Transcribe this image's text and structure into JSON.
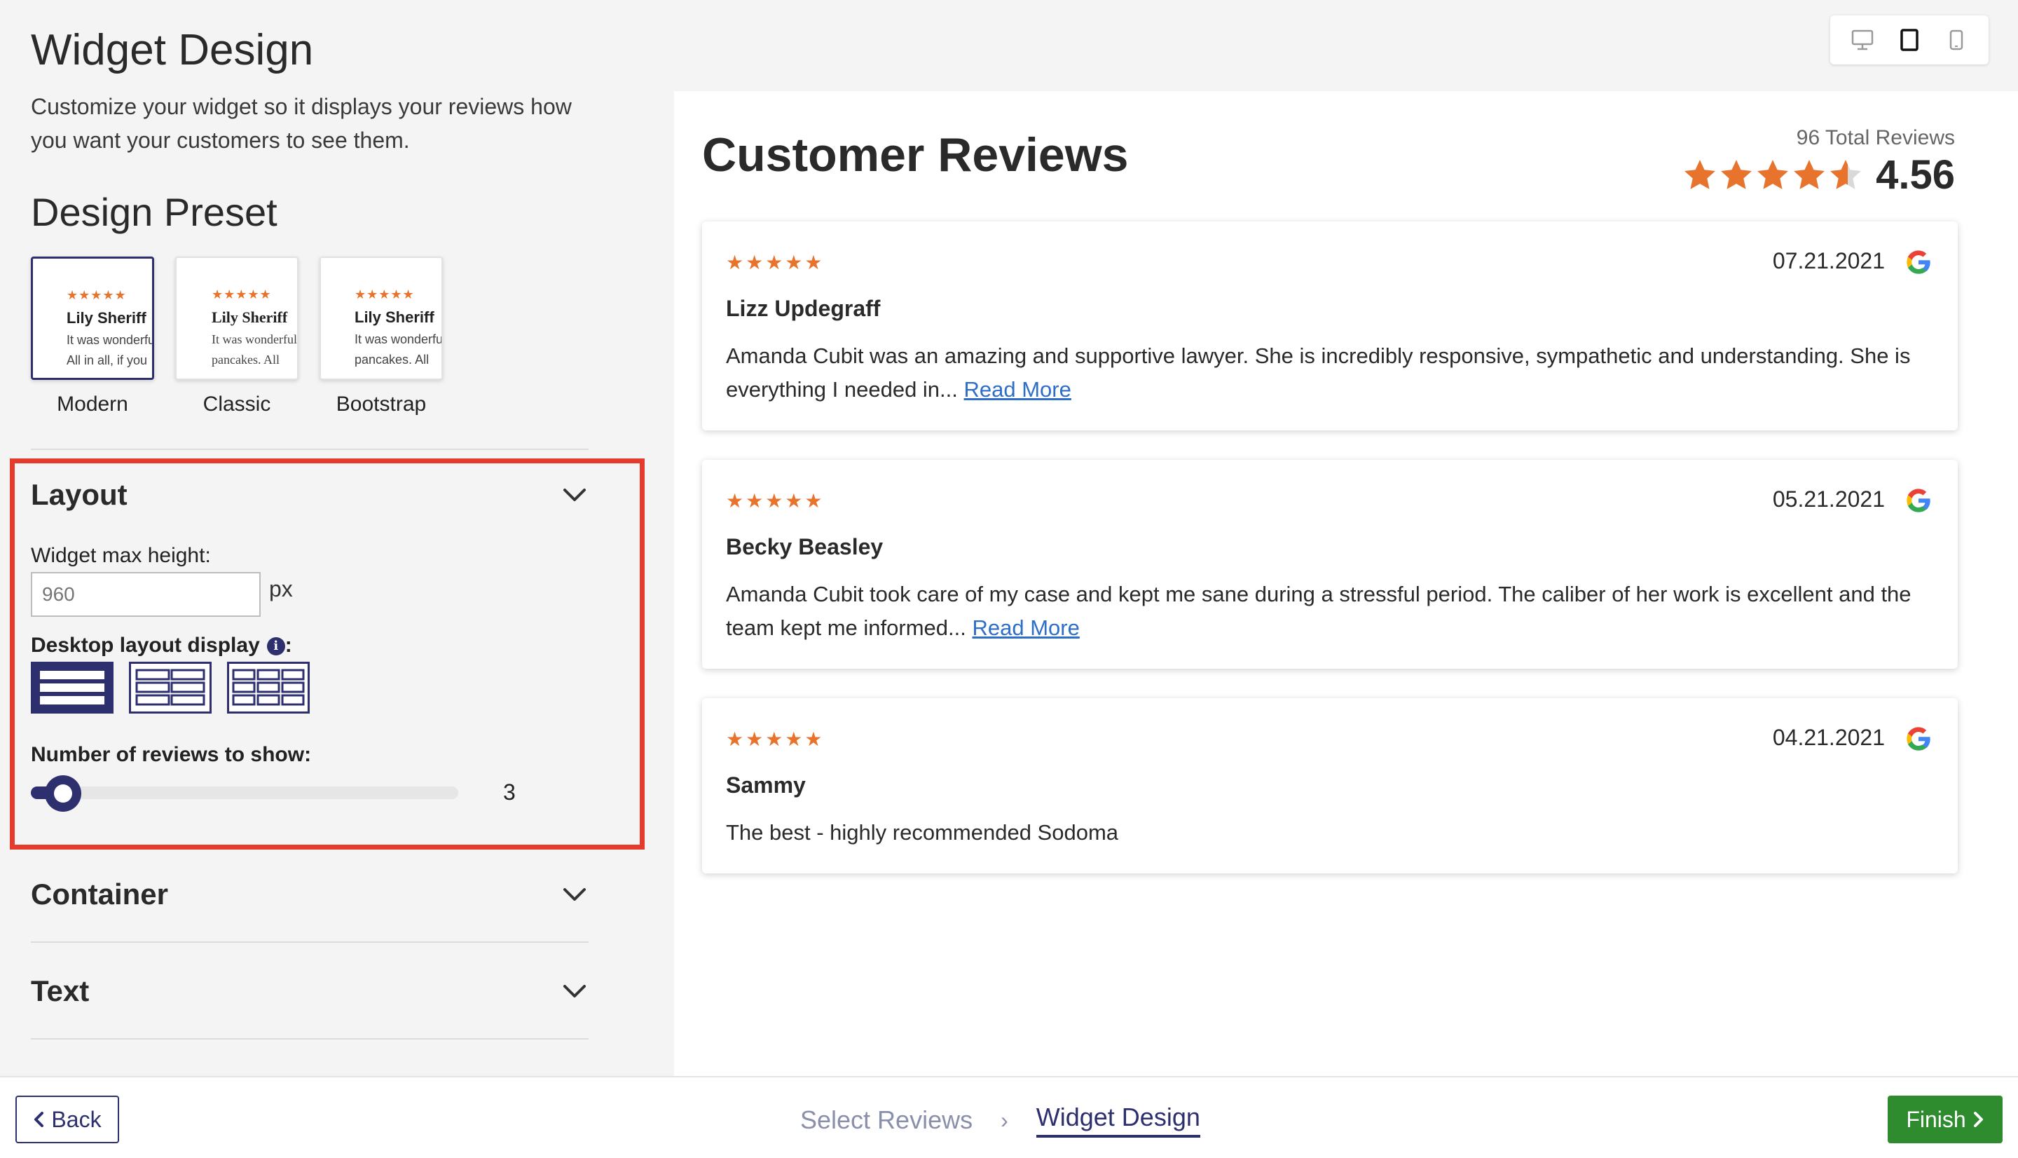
{
  "page": {
    "title": "Widget Design",
    "subtitle": "Customize your widget so it displays your reviews how you want your customers to see them."
  },
  "design_preset": {
    "title": "Design Preset",
    "presets": [
      {
        "label": "Modern",
        "name": "Lily Sheriff",
        "line1": "It was wonderful",
        "line2": "All in all, if you",
        "active": true
      },
      {
        "label": "Classic",
        "name": "Lily Sheriff",
        "line1": "It was wonderful",
        "line2": "pancakes. All",
        "active": false
      },
      {
        "label": "Bootstrap",
        "name": "Lily Sheriff",
        "line1": "It was wonderful",
        "line2": "pancakes. All",
        "active": false
      }
    ],
    "stars": "★★★★★"
  },
  "layout": {
    "title": "Layout",
    "max_height_label": "Widget max height:",
    "max_height_placeholder": "960",
    "unit": "px",
    "desktop_layout_label": "Desktop layout display",
    "info_glyph": "i",
    "colon": ":",
    "layout_options": [
      "one-column",
      "two-column",
      "three-column"
    ],
    "selected_layout": "one-column",
    "reviews_count_label": "Number of reviews to show:",
    "reviews_count": "3",
    "reviews_count_fraction": 0.0
  },
  "sections": {
    "container": "Container",
    "text": "Text"
  },
  "device_toggle": {
    "options": [
      "desktop-icon",
      "tablet-icon",
      "mobile-icon"
    ],
    "selected": "tablet-icon"
  },
  "preview": {
    "title": "Customer Reviews",
    "total_reviews": "96 Total Reviews",
    "rating": "4.56",
    "rating_value": 4.56,
    "reviews": [
      {
        "stars": "★★★★★",
        "date": "07.21.2021",
        "name": "Lizz Updegraff",
        "text": "Amanda Cubit was an amazing and supportive lawyer. She is incredibly responsive, sympathetic and understanding. She is everything I needed in...",
        "read_more": "Read More"
      },
      {
        "stars": "★★★★★",
        "date": "05.21.2021",
        "name": "Becky Beasley",
        "text": "Amanda Cubit took care of my case and kept me sane during a stressful period. The caliber of her work is excellent and the team kept me informed...",
        "read_more": "Read More"
      },
      {
        "stars": "★★★★★",
        "date": "04.21.2021",
        "name": "Sammy",
        "text": "The best - highly recommended Sodoma",
        "read_more": ""
      }
    ]
  },
  "footer": {
    "back_label": "Back",
    "step1": "Select Reviews",
    "step_separator": "›",
    "step2": "Widget Design",
    "finish_label": "Finish"
  },
  "colors": {
    "primary": "#2d2f6e",
    "star": "#e8732c",
    "highlight_border": "#e53b2c",
    "finish": "#2e8b2e",
    "link": "#2d6ec9"
  }
}
